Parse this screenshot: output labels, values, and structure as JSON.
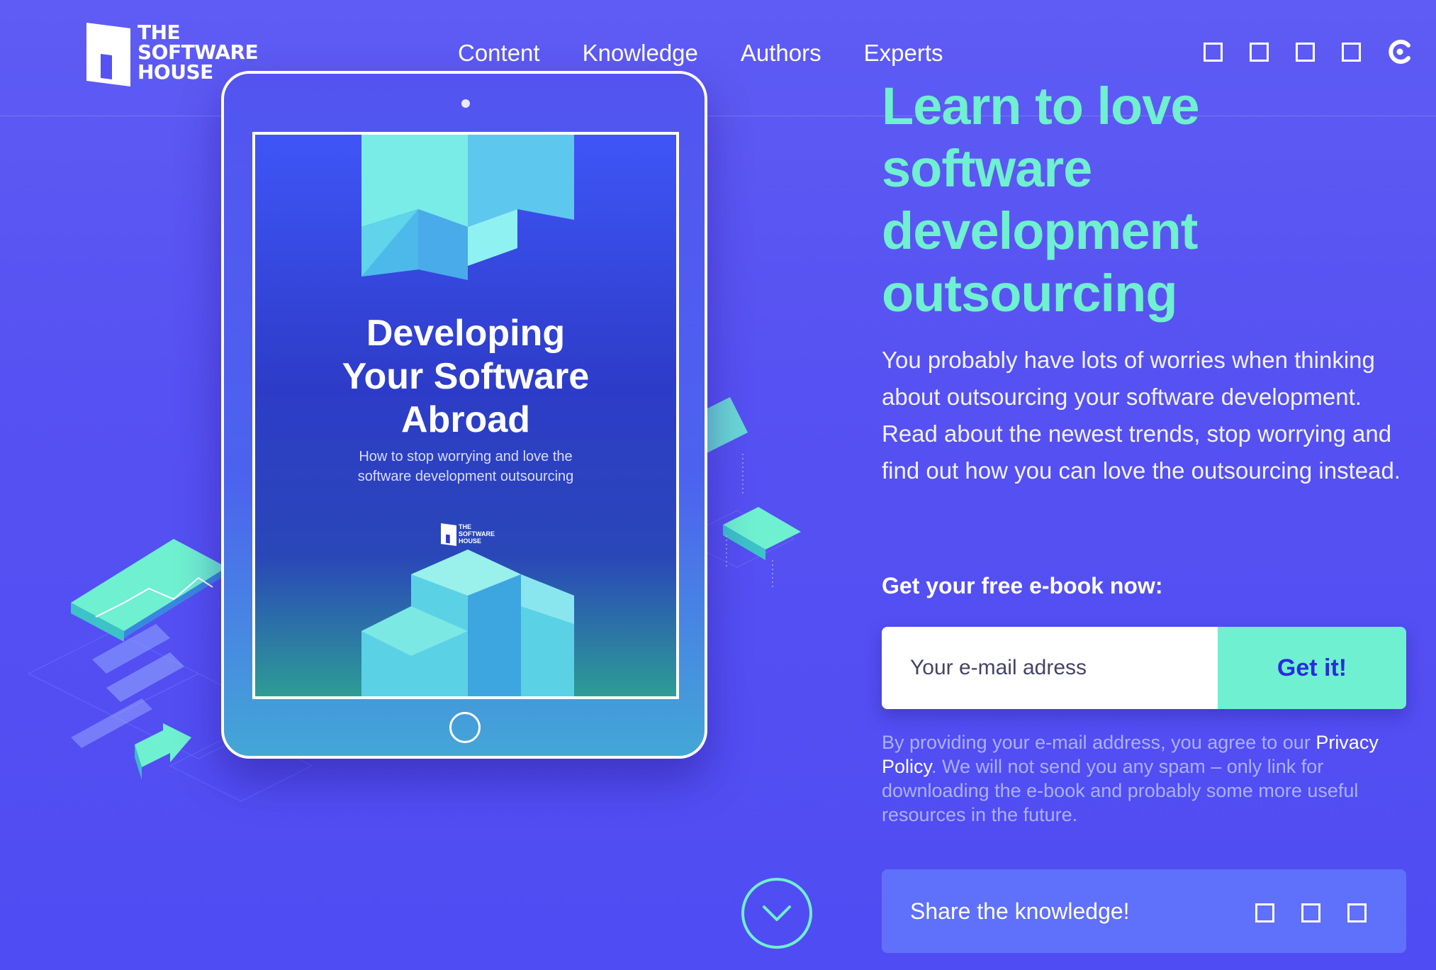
{
  "brand": {
    "logo_lines": [
      "THE",
      "SOFTWARE",
      "HOUSE"
    ]
  },
  "nav": {
    "items": [
      "Content",
      "Knowledge",
      "Authors",
      "Experts"
    ]
  },
  "social": {
    "icons": [
      "square-icon",
      "square-icon",
      "square-icon",
      "square-icon",
      "clutch-icon"
    ]
  },
  "ebook": {
    "title_lines": [
      "Developing",
      "Your Software",
      "Abroad"
    ],
    "subtitle": "How to stop worrying and love the software development outsourcing",
    "logo_lines": [
      "THE",
      "SOFTWARE",
      "HOUSE"
    ]
  },
  "hero": {
    "headline_lines": [
      "Learn to love",
      "software",
      "development",
      "outsourcing"
    ],
    "intro": "You probably have lots of worries when thinking about outsourcing your software development. Read about the newest trends, stop worrying and find out how you can love the outsourcing instead."
  },
  "form": {
    "label": "Get your free e-book now:",
    "email_placeholder": "Your e-mail adress",
    "email_value": "",
    "submit_label": "Get it!"
  },
  "disclaimer": {
    "before": "By providing your e-mail address, you agree to our ",
    "link": "Privacy Policy",
    "after": ". We will not send you any spam – only link for downloading the e-book and probably some more useful resources in the future."
  },
  "share": {
    "label": "Share the knowledge!"
  },
  "colors": {
    "accent": "#6ff0d0",
    "background": "#5651f2",
    "button_text": "#2a2be0"
  }
}
